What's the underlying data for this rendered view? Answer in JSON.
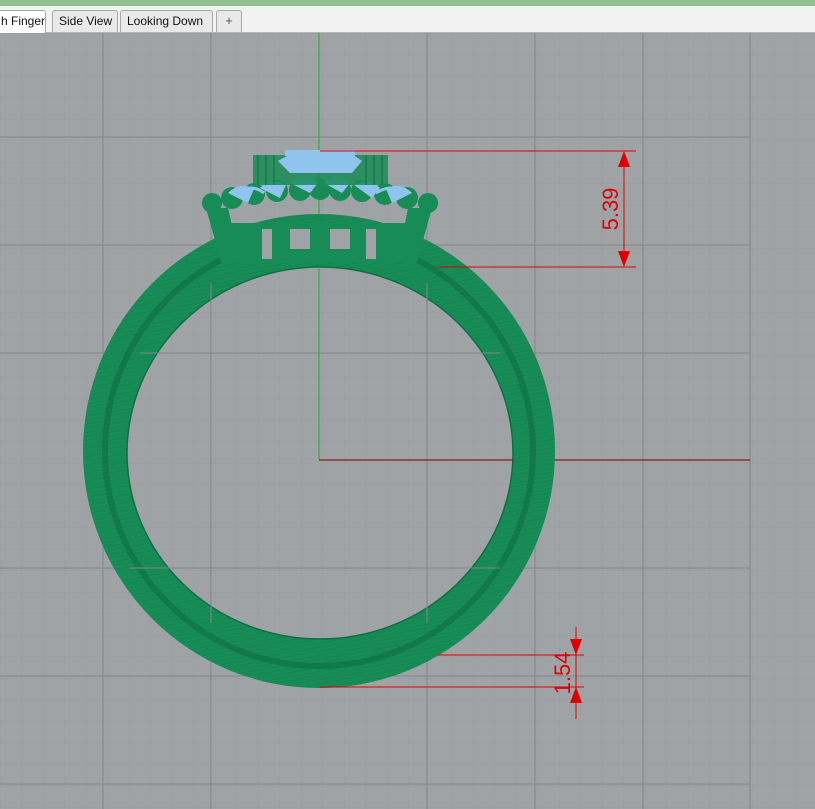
{
  "tabs": [
    {
      "label": "h Finger",
      "active": true
    },
    {
      "label": "Side View",
      "active": false
    },
    {
      "label": "Looking Down",
      "active": false
    }
  ],
  "add_tab_label": "+",
  "dimensions": {
    "top_height": "5.39",
    "band_thickness": "1.54"
  },
  "colors": {
    "background": "#9fa3a6",
    "grid": "#8e9295",
    "grid_major": "#7f8386",
    "ring": "#178c56",
    "ring_dark": "#0f6e42",
    "stone": "#8fc4ef",
    "dimension": "#e00000",
    "y_axis": "#2bb52b",
    "x_axis": "#8a1b1b"
  }
}
